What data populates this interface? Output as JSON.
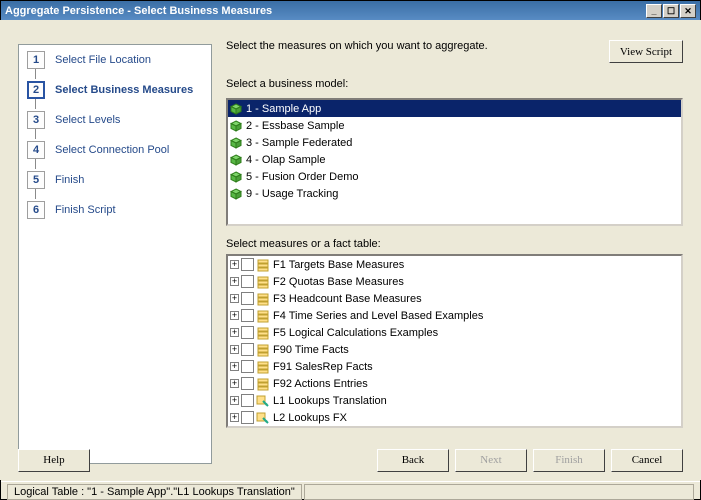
{
  "window": {
    "title": "Aggregate Persistence - Select Business Measures"
  },
  "instruction": "Select the measures on which you want to aggregate.",
  "view_script_label": "View Script",
  "bm_label": "Select a business model:",
  "measures_label": "Select measures or a fact table:",
  "steps": [
    {
      "num": "1",
      "label": "Select File Location"
    },
    {
      "num": "2",
      "label": "Select Business Measures"
    },
    {
      "num": "3",
      "label": "Select Levels"
    },
    {
      "num": "4",
      "label": "Select Connection Pool"
    },
    {
      "num": "5",
      "label": "Finish"
    },
    {
      "num": "6",
      "label": "Finish Script"
    }
  ],
  "active_step": 1,
  "business_models": [
    {
      "label": "1 - Sample App",
      "selected": true
    },
    {
      "label": "2 - Essbase Sample"
    },
    {
      "label": "3 - Sample Federated"
    },
    {
      "label": "4 - Olap Sample"
    },
    {
      "label": "5 - Fusion Order Demo"
    },
    {
      "label": "9 - Usage Tracking"
    }
  ],
  "fact_tables": [
    {
      "label": "F1 Targets Base Measures",
      "type": "fact"
    },
    {
      "label": "F2 Quotas Base Measures",
      "type": "fact"
    },
    {
      "label": "F3 Headcount Base Measures",
      "type": "fact"
    },
    {
      "label": "F4 Time Series and Level Based Examples",
      "type": "fact"
    },
    {
      "label": "F5 Logical Calculations Examples",
      "type": "fact"
    },
    {
      "label": "F90 Time Facts",
      "type": "fact"
    },
    {
      "label": "F91 SalesRep Facts",
      "type": "fact"
    },
    {
      "label": "F92 Actions Entries",
      "type": "fact"
    },
    {
      "label": "L1 Lookups Translation",
      "type": "lookup"
    },
    {
      "label": "L2 Lookups FX",
      "type": "lookup"
    }
  ],
  "buttons": {
    "help": "Help",
    "back": "Back",
    "next": "Next",
    "finish": "Finish",
    "cancel": "Cancel"
  },
  "status": "Logical Table : \"1 - Sample App\".\"L1 Lookups Translation\""
}
